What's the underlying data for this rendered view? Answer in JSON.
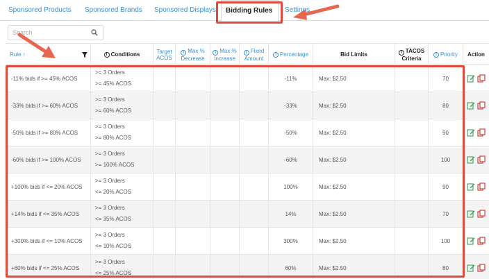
{
  "tabs": [
    {
      "label": "Sponsored Products"
    },
    {
      "label": "Sponsored Brands"
    },
    {
      "label": "Sponsored Displays"
    },
    {
      "label": "Bidding Rules"
    },
    {
      "label": "Settings"
    }
  ],
  "active_tab": "Bidding Rules",
  "search": {
    "placeholder": "Search",
    "value": ""
  },
  "columns": {
    "rule": "Rule ↑",
    "conditions": "Conditions",
    "target_acos": "Target ACOS",
    "max_decrease": "Max % Decrease",
    "max_increase": "Max % Increase",
    "fixed_amount": "Fixed Amount",
    "percentage": "Percentage",
    "bid_limits": "Bid Limits",
    "tacos_criteria": "TACOS Criteria",
    "priority": "Priority",
    "action": "Action"
  },
  "rows": [
    {
      "rule": "-11% bids if >= 45% ACOS",
      "cond1": ">= 3 Orders",
      "cond2": ">= 45% ACOS",
      "percentage": "-11%",
      "bid_limits": "Max: $2.50",
      "priority": "70"
    },
    {
      "rule": "-33% bids if >= 60% ACOS",
      "cond1": ">= 3 Orders",
      "cond2": ">= 60% ACOS",
      "percentage": "-33%",
      "bid_limits": "Max: $2.50",
      "priority": "80"
    },
    {
      "rule": "-50% bids if >= 80% ACOS",
      "cond1": ">= 3 Orders",
      "cond2": ">= 80% ACOS",
      "percentage": "-50%",
      "bid_limits": "Max: $2.50",
      "priority": "90"
    },
    {
      "rule": "-60% bids if >= 100% ACOS",
      "cond1": ">= 3 Orders",
      "cond2": ">= 100% ACOS",
      "percentage": "-60%",
      "bid_limits": "Max: $2.50",
      "priority": "100"
    },
    {
      "rule": "+100% bids if <= 20% ACOS",
      "cond1": ">= 3 Orders",
      "cond2": "<= 20% ACOS",
      "percentage": "100%",
      "bid_limits": "Max: $2.50",
      "priority": "90"
    },
    {
      "rule": "+14% bids if <= 35% ACOS",
      "cond1": ">= 3 Orders",
      "cond2": "<= 35% ACOS",
      "percentage": "14%",
      "bid_limits": "Max: $2.50",
      "priority": "70"
    },
    {
      "rule": "+300% bids if <= 10% ACOS",
      "cond1": ">= 3 Orders",
      "cond2": "<= 10% ACOS",
      "percentage": "300%",
      "bid_limits": "Max: $2.50",
      "priority": "100"
    },
    {
      "rule": "+60% bids if <= 25% ACOS",
      "cond1": ">= 3 Orders",
      "cond2": "<= 25% ACOS",
      "percentage": "60%",
      "bid_limits": "Max: $2.50",
      "priority": "80"
    }
  ],
  "colors": {
    "tab_link": "#3a8fce",
    "highlight": "#e14a3b",
    "edit_icon": "#3aa35a",
    "copy_icon": "#c9302c",
    "row_alt": "#f4f4f4"
  },
  "icons": {
    "search": "search-icon",
    "filter": "filter-icon",
    "info": "info-icon",
    "edit": "edit-icon",
    "copy": "copy-icon",
    "sort": "sort-asc-icon"
  }
}
